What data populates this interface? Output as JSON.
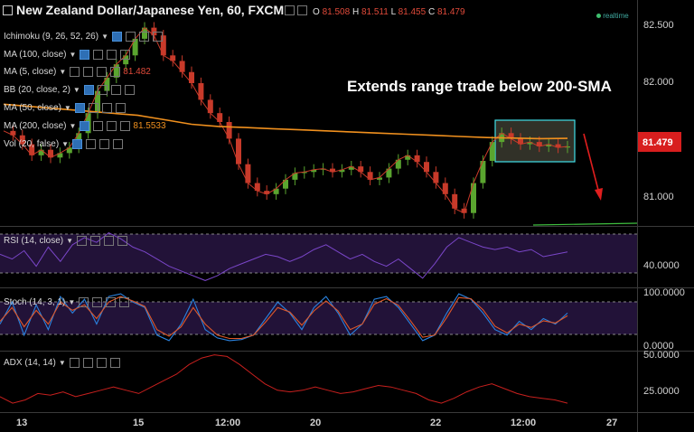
{
  "header": {
    "title": "New Zealand Dollar/Japanese Yen, 60, FXCM",
    "ohlc": [
      {
        "label": "O",
        "value": "81.508"
      },
      {
        "label": "H",
        "value": "81.511"
      },
      {
        "label": "L",
        "value": "81.455"
      },
      {
        "label": "C",
        "value": "81.479"
      }
    ],
    "realtime_label": "realtime"
  },
  "indicators": [
    {
      "label": "Ichimoku (9, 26, 52, 26)",
      "value": ""
    },
    {
      "label": "MA (100, close)",
      "value": ""
    },
    {
      "label": "MA (5, close)",
      "value": "81.482"
    },
    {
      "label": "BB (20, close, 2)",
      "value": ""
    },
    {
      "label": "MA (50, close)",
      "value": ""
    },
    {
      "label": "MA (200, close)",
      "value": "81.5533"
    },
    {
      "label": "Vol (20, false)",
      "value": ""
    }
  ],
  "annotation": "Extends range trade below 200-SMA",
  "price_badge": "81.479",
  "colors": {
    "up": "#5aa52f",
    "down": "#c83a2a",
    "sma200": "#f0901e",
    "rsi": "#7a46c8",
    "stoch_k": "#2a83e0",
    "stoch_d": "#e0582a",
    "adx": "#c8201e",
    "badge": "#d81e1e",
    "box": "#40e0e8"
  },
  "chart_data": [
    {
      "type": "line",
      "name": "price",
      "y_ticks": [
        "82.500",
        "82.000",
        "81.000"
      ],
      "x_ticks": [
        "13",
        "15",
        "12:00",
        "20",
        "22",
        "12:00",
        "12:00",
        "27"
      ],
      "ylim": [
        80.78,
        82.62
      ],
      "series": [
        {
          "name": "close",
          "values": [
            81.62,
            81.58,
            81.5,
            81.4,
            81.45,
            81.38,
            81.42,
            81.47,
            81.6,
            81.78,
            81.98,
            82.1,
            82.22,
            82.3,
            82.45,
            82.55,
            82.48,
            82.3,
            82.25,
            82.15,
            82.05,
            81.9,
            81.78,
            81.7,
            81.55,
            81.32,
            81.15,
            81.08,
            81.05,
            81.1,
            81.18,
            81.24,
            81.25,
            81.27,
            81.28,
            81.25,
            81.27,
            81.3,
            81.25,
            81.18,
            81.2,
            81.28,
            81.36,
            81.4,
            81.34,
            81.25,
            81.15,
            81.05,
            80.92,
            80.88,
            81.15,
            81.35,
            81.52,
            81.6,
            81.55,
            81.5,
            81.52,
            81.48,
            81.5,
            81.47,
            81.48
          ]
        },
        {
          "name": "MA (200, close)",
          "values": [
            81.86,
            81.84,
            81.82,
            81.8,
            81.78,
            81.76,
            81.72,
            81.68,
            81.66,
            81.65,
            81.64,
            81.63,
            81.62,
            81.61,
            81.6,
            81.59,
            81.58,
            81.57,
            81.56,
            81.555,
            81.55,
            81.553
          ]
        }
      ]
    },
    {
      "type": "line",
      "name": "RSI (14, close)",
      "y_ticks": [
        "40.0000"
      ],
      "ylim": [
        25,
        75
      ],
      "series": [
        {
          "name": "RSI",
          "values": [
            52,
            48,
            55,
            42,
            58,
            46,
            60,
            66,
            62,
            70,
            65,
            58,
            54,
            48,
            42,
            38,
            34,
            30,
            34,
            40,
            44,
            48,
            52,
            50,
            46,
            50,
            56,
            60,
            54,
            48,
            52,
            46,
            42,
            48,
            40,
            32,
            44,
            58,
            66,
            62,
            58,
            56,
            58,
            54,
            56,
            50,
            52,
            54
          ]
        }
      ]
    },
    {
      "type": "line",
      "name": "Stoch (14, 3, 1)",
      "y_ticks": [
        "100.0000",
        "0.0000"
      ],
      "ylim": [
        0,
        100
      ],
      "series": [
        {
          "name": "%K",
          "values": [
            40,
            80,
            20,
            75,
            30,
            90,
            60,
            85,
            40,
            90,
            95,
            80,
            70,
            20,
            10,
            40,
            85,
            30,
            15,
            10,
            12,
            20,
            50,
            80,
            60,
            30,
            70,
            90,
            60,
            20,
            40,
            85,
            90,
            70,
            40,
            10,
            20,
            60,
            95,
            85,
            60,
            30,
            20,
            45,
            30,
            50,
            40,
            60
          ]
        },
        {
          "name": "%D",
          "values": [
            45,
            70,
            35,
            65,
            40,
            80,
            65,
            75,
            50,
            80,
            90,
            82,
            72,
            30,
            18,
            35,
            70,
            40,
            20,
            14,
            14,
            20,
            44,
            70,
            62,
            38,
            64,
            82,
            64,
            30,
            40,
            76,
            86,
            74,
            46,
            16,
            20,
            52,
            88,
            86,
            66,
            36,
            24,
            40,
            34,
            46,
            42,
            55
          ]
        }
      ]
    },
    {
      "type": "line",
      "name": "ADX (14, 14)",
      "y_ticks": [
        "50.0000",
        "25.0000"
      ],
      "ylim": [
        15,
        52
      ],
      "series": [
        {
          "name": "ADX",
          "values": [
            24,
            20,
            22,
            26,
            25,
            27,
            24,
            26,
            28,
            30,
            28,
            26,
            30,
            34,
            38,
            44,
            48,
            50,
            49,
            44,
            38,
            32,
            28,
            27,
            28,
            30,
            28,
            26,
            27,
            29,
            31,
            30,
            28,
            26,
            22,
            20,
            23,
            27,
            30,
            32,
            29,
            26,
            24,
            23,
            22,
            20
          ]
        }
      ]
    }
  ]
}
